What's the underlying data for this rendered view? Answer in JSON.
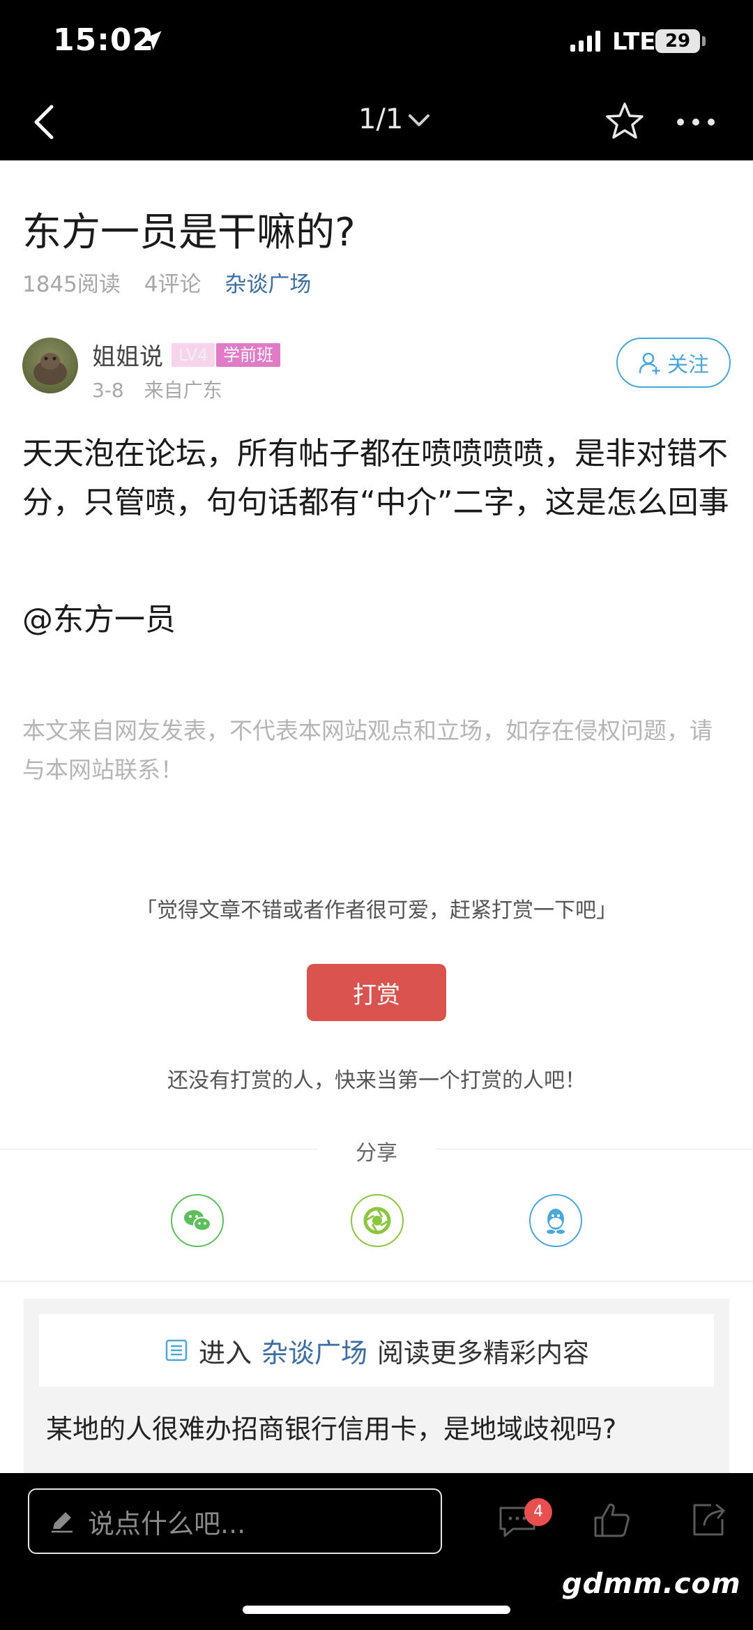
{
  "status_bar": {
    "time": "15:02",
    "network": "LTE",
    "battery": "29"
  },
  "nav": {
    "page_indicator": "1/1"
  },
  "article": {
    "title": "东方一员是干嘛的?",
    "reads": "1845阅读",
    "comments": "4评论",
    "forum": "杂谈广场",
    "author": {
      "name": "姐姐说",
      "level": "LV4",
      "tag": "学前班",
      "date": "3-8",
      "location": "来自广东",
      "follow_label": "关注"
    },
    "body": "天天泡在论坛，所有帖子都在喷喷喷喷，是非对错不分，只管喷，句句话都有“中介”二字，这是怎么回事",
    "mention": "@东方一员",
    "disclaimer": "本文来自网友发表，不代表本网站观点和立场，如存在侵权问题，请与本网站联系！"
  },
  "reward": {
    "prompt": "「觉得文章不错或者作者很可爱，赶紧打赏一下吧」",
    "button_label": "打赏",
    "empty_text": "还没有打赏的人，快来当第一个打赏的人吧！"
  },
  "share": {
    "label": "分享",
    "icons": [
      "wechat-icon",
      "moments-icon",
      "qq-icon"
    ]
  },
  "more": {
    "enter_prefix": "进入",
    "forum_link": "杂谈广场",
    "enter_suffix": "阅读更多精彩内容",
    "related_title": "某地的人很难办招商银行信用卡，是地域歧视吗?"
  },
  "bottom_bar": {
    "input_placeholder": "说点什么吧...",
    "comment_count": "4",
    "watermark": "gdmm.com"
  },
  "colors": {
    "accent_blue": "#3b6ea5",
    "follow_blue": "#47a8d8",
    "reward_red": "#d9534f",
    "badge_pink": "#e07bc7"
  }
}
